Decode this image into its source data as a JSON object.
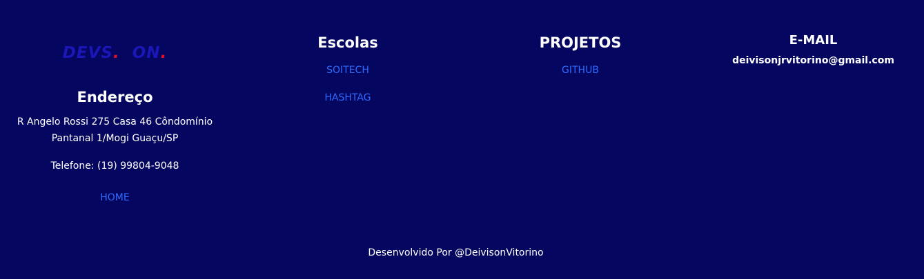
{
  "brand": {
    "part1": "DEVS",
    "dot1": ".",
    "part2": "ON",
    "dot2": ".",
    "color": "#1b16b8",
    "dot_color": "#e3102b"
  },
  "address": {
    "title": "Endereço",
    "line": "R Angelo Rossi 275 Casa 46 Côndomínio Pantanal 1/Mogi Guaçu/SP",
    "phone": "Telefone: (19) 99804-9048",
    "home_link": "HOME"
  },
  "schools": {
    "title": "Escolas",
    "links": [
      "SOITECH",
      "HASHTAG"
    ]
  },
  "projects": {
    "title": "PROJETOS",
    "links": [
      "GITHUB"
    ]
  },
  "email": {
    "title": "E-MAIL",
    "address": "deivisonjrvitorino@gmail.com"
  },
  "footer": {
    "credit": "Desenvolvido Por @DeivisonVitorino"
  },
  "colors": {
    "background": "#05065f",
    "link": "#2f6bff",
    "text": "#ffffff"
  }
}
